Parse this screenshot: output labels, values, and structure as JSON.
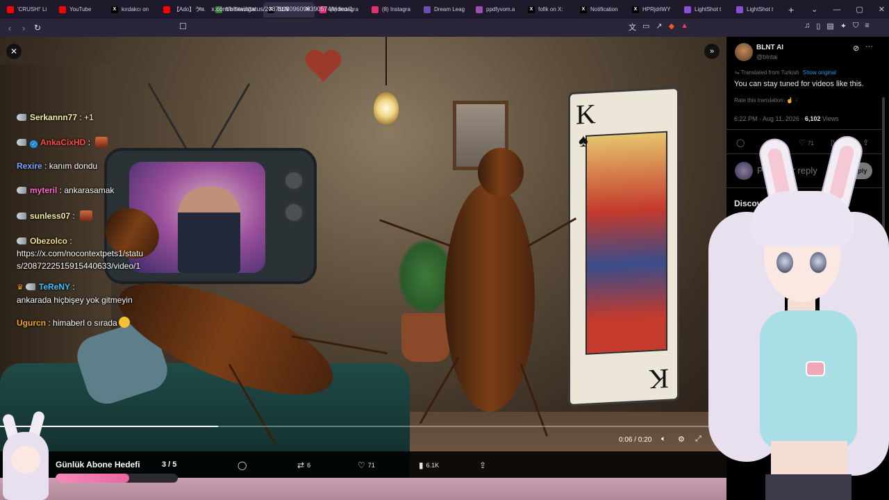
{
  "browser": {
    "tabs": [
      {
        "label": "'CRUSH!' Li",
        "icon": "youtube-icon",
        "color": "#ff0000"
      },
      {
        "label": "YouTube",
        "icon": "youtube-icon",
        "color": "#ff0000"
      },
      {
        "label": "kırdakcı on",
        "icon": "x-icon",
        "color": "#000000"
      },
      {
        "label": "【Ado】うっせ",
        "icon": "youtube-icon",
        "color": "#ff0000"
      },
      {
        "label": "En Sevdiğin",
        "icon": "app-icon",
        "color": "#3a7a3a"
      },
      {
        "label": "BLN",
        "icon": "x-icon",
        "color": "#000000",
        "active": true
      },
      {
        "label": "(8) Instagra",
        "icon": "instagram-icon",
        "color": "#e1306c"
      },
      {
        "label": "(8) Instagra",
        "icon": "instagram-icon",
        "color": "#e1306c"
      },
      {
        "label": "Dream Leag",
        "icon": "app-icon",
        "color": "#6a4fb0"
      },
      {
        "label": "ppdfyvom.a",
        "icon": "app-icon",
        "color": "#a04fb0"
      },
      {
        "label": "fofik on X:",
        "icon": "x-icon",
        "color": "#000000"
      },
      {
        "label": "Notification",
        "icon": "x-icon",
        "color": "#000000"
      },
      {
        "label": "HPRjdrlWY",
        "icon": "x-icon",
        "color": "#000000"
      },
      {
        "label": "LightShot t",
        "icon": "lightshot-icon",
        "color": "#8a4fd0"
      },
      {
        "label": "LightShot t",
        "icon": "lightshot-icon",
        "color": "#8a4fd0"
      }
    ],
    "url": "x.com/blntai/status/2087198096090390574/video/1"
  },
  "video": {
    "time": "0:06 / 0:20",
    "progress_fraction": 0.3,
    "actions": {
      "replies": "",
      "reposts": "6",
      "likes": "71",
      "views": "6.1K"
    }
  },
  "chat": [
    {
      "user": "Serkannn77",
      "user_color": "#f5f0a0",
      "sep": " : ",
      "msg": "+1",
      "badge": true
    },
    {
      "user": "AnkaCixHD",
      "user_color": "#ff4a4a",
      "sep": " : ",
      "msg": "",
      "badge": true,
      "verified": true,
      "emote": true
    },
    {
      "user": "Rexire",
      "user_color": "#7aa8ff",
      "sep": " : ",
      "msg": "kanım dondu"
    },
    {
      "user": "myteril",
      "user_color": "#ff6ad0",
      "sep": " : ",
      "msg": "ankarasamak",
      "badge": true
    },
    {
      "user": "sunless07",
      "user_color": "#f5f0a0",
      "sep": " : ",
      "msg": "",
      "badge": true,
      "emote": true
    },
    {
      "user": "Obezolco",
      "user_color": "#f5e08a",
      "sep": " :",
      "msg": "https://x.com/nocontextpets1/statu",
      "msg2": "s/2087222515915440633/video/1",
      "badge": true
    },
    {
      "user": "TeReNY",
      "user_color": "#3ac8ff",
      "sep": " :",
      "msg": "ankarada hiçbişey yok gitmeyin",
      "badge": true,
      "crown": true
    },
    {
      "user": "Ugurcn",
      "user_color": "#f5a623",
      "sep": " : ",
      "msg": "himaberl o sırada",
      "emoji": true
    }
  ],
  "tweet": {
    "name": "BLNT AI",
    "handle": "@blntai",
    "translated_prefix": "Translated from Turkish",
    "show_original": "Show original",
    "text": "You can stay tuned for videos like this.",
    "rate_translation": "Rate this translation:",
    "time": "6:22 PM · Aug 11, 2026 · ",
    "views_count": "6,102",
    "views_label": " Views",
    "like_count": "71",
    "reply_placeholder": "Post your reply",
    "reply_button": "Reply",
    "discover": "Discover"
  },
  "goal": {
    "title": "Günlük Abone Hedefi",
    "count": "3 / 5",
    "fraction": 0.6
  }
}
